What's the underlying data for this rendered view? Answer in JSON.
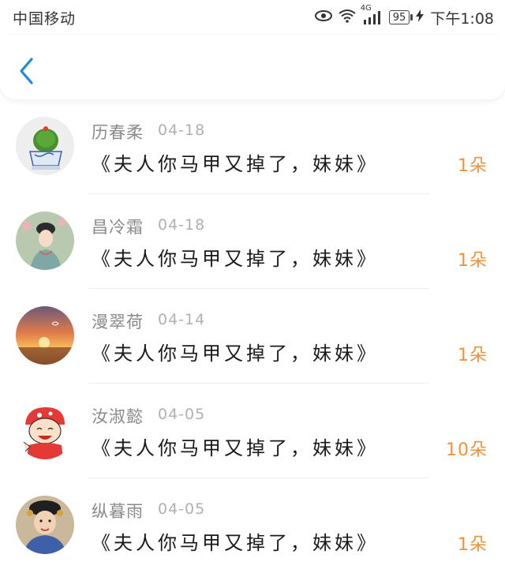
{
  "status_bar": {
    "carrier": "中国移动",
    "network": "4G",
    "battery": "95",
    "time": "下午1:08"
  },
  "items": [
    {
      "name": "历春柔",
      "date": "04-18",
      "title": "《夫人你马甲又掉了，妹妹》",
      "count": "1朵",
      "avatar": "cactus"
    },
    {
      "name": "昌冷霜",
      "date": "04-18",
      "title": "《夫人你马甲又掉了，妹妹》",
      "count": "1朵",
      "avatar": "ancient-lady"
    },
    {
      "name": "漫翠荷",
      "date": "04-14",
      "title": "《夫人你马甲又掉了，妹妹》",
      "count": "1朵",
      "avatar": "sunset"
    },
    {
      "name": "汝淑懿",
      "date": "04-05",
      "title": "《夫人你马甲又掉了，妹妹》",
      "count": "10朵",
      "avatar": "cartoon-boy"
    },
    {
      "name": "纵暮雨",
      "date": "04-05",
      "title": "《夫人你马甲又掉了，妹妹》",
      "count": "1朵",
      "avatar": "drama-girl"
    }
  ],
  "colors": {
    "accent": "#f0923a",
    "back": "#1e88e5"
  }
}
